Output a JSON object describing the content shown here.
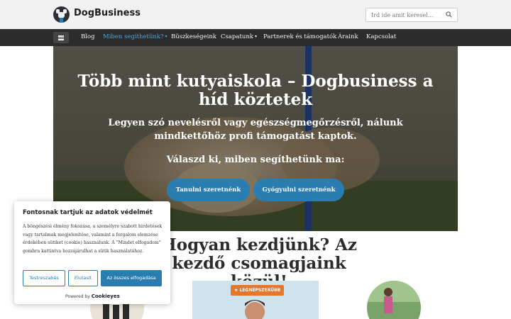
{
  "header": {
    "brand": "DogBusiness",
    "search_placeholder": "Írd ide amit keresel..."
  },
  "nav": {
    "items": [
      {
        "label": "Blog"
      },
      {
        "label": "Miben segíthetünk?",
        "dropdown": true,
        "active": true
      },
      {
        "label": "Büszkeségeink"
      },
      {
        "label": "Csapatunk",
        "dropdown": true
      },
      {
        "label": "Partnerek és támogatók"
      },
      {
        "label": "Áraink"
      },
      {
        "label": "Kapcsolat"
      }
    ]
  },
  "hero": {
    "title": "Több mint kutyaiskola – Dogbusiness a híd köztetek",
    "subtitle": "Legyen szó nevelésről vagy egészségmegőrzésről, nálunk mindkettőhöz profi támogatást kaptok.",
    "cta_text": "Válaszd ki, miben segíthetünk ma:",
    "button_learn": "Tanulni szeretnénk",
    "button_heal": "Gyógyulni szeretnénk"
  },
  "section": {
    "title": "Hogyan kezdjünk? Az kezdő csomagjaink közül!",
    "badge": "LEGNÉPSZERŰBB"
  },
  "cookie_banner": {
    "title": "Fontosnak tartjuk az adatok védelmét",
    "text": "A böngészési élmény fokozása, a személyre szabott hirdetések vagy tartalmak megjelenítése, valamint a forgalom elemzése érdekében sütiket (cookie) használunk. A \"Mindet elfogadom\" gombra kattintva hozzájárulhat a sütik használatához.",
    "btn_customize": "Testreszabás",
    "btn_reject": "Elutasít",
    "btn_accept": "Az összes elfogadása",
    "powered_by": "Powered by",
    "powered_brand": "Cookieyes"
  },
  "colors": {
    "accent": "#2a7db1",
    "nav_bg": "#2c2c2c",
    "nav_active": "#4ea6db",
    "badge": "#e4772a"
  }
}
